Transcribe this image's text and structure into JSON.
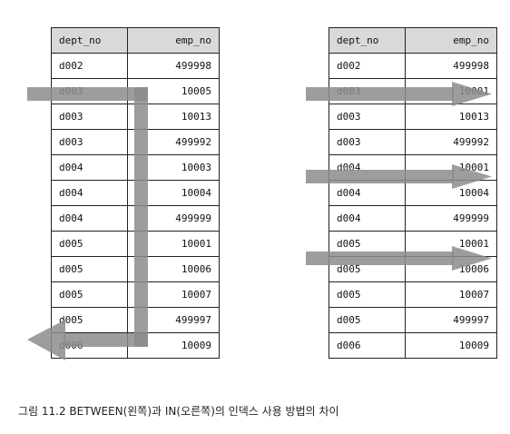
{
  "left_table": {
    "headers": [
      "dept_no",
      "emp_no"
    ],
    "rows": [
      [
        "d002",
        "499998"
      ],
      [
        "d003",
        "10005"
      ],
      [
        "d003",
        "10013"
      ],
      [
        "d003",
        "499992"
      ],
      [
        "d004",
        "10003"
      ],
      [
        "d004",
        "10004"
      ],
      [
        "d004",
        "499999"
      ],
      [
        "d005",
        "10001"
      ],
      [
        "d005",
        "10006"
      ],
      [
        "d005",
        "10007"
      ],
      [
        "d005",
        "499997"
      ],
      [
        "d006",
        "10009"
      ]
    ]
  },
  "right_table": {
    "headers": [
      "dept_no",
      "emp_no"
    ],
    "rows": [
      [
        "d002",
        "499998"
      ],
      [
        "d003",
        "10001"
      ],
      [
        "d003",
        "10013"
      ],
      [
        "d003",
        "499992"
      ],
      [
        "d004",
        "10001"
      ],
      [
        "d004",
        "10004"
      ],
      [
        "d004",
        "499999"
      ],
      [
        "d005",
        "10001"
      ],
      [
        "d005",
        "10006"
      ],
      [
        "d005",
        "10007"
      ],
      [
        "d005",
        "499997"
      ],
      [
        "d006",
        "10009"
      ]
    ]
  },
  "colors": {
    "header_bg": "#d9d9d9",
    "arrow": "#8c8c8c",
    "border": "#222222"
  },
  "caption": "그림 11.2 BETWEEN(왼쪽)과 IN(오른쪽)의 인덱스 사용 방법의 차이"
}
